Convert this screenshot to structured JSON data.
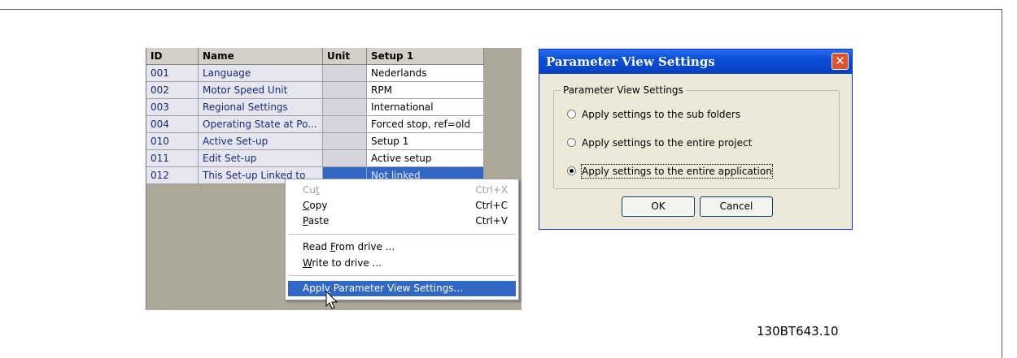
{
  "grid": {
    "columns": [
      "ID",
      "Name",
      "Unit",
      "Setup 1"
    ],
    "rows": [
      {
        "id": "001",
        "name": "Language",
        "unit": "",
        "value": "Nederlands"
      },
      {
        "id": "002",
        "name": "Motor Speed Unit",
        "unit": "",
        "value": "RPM"
      },
      {
        "id": "003",
        "name": "Regional Settings",
        "unit": "",
        "value": "International"
      },
      {
        "id": "004",
        "name": "Operating State at Po...",
        "unit": "",
        "value": "Forced stop, ref=old"
      },
      {
        "id": "010",
        "name": "Active Set-up",
        "unit": "",
        "value": "Setup 1"
      },
      {
        "id": "011",
        "name": "Edit Set-up",
        "unit": "",
        "value": "Active setup"
      },
      {
        "id": "012",
        "name": "This Set-up Linked to",
        "unit": "",
        "value": "Not linked"
      }
    ]
  },
  "context_menu": {
    "cut": {
      "pre": "Cu",
      "key": "t",
      "post": "",
      "shortcut": "Ctrl+X"
    },
    "copy": {
      "pre": "",
      "key": "C",
      "post": "opy",
      "shortcut": "Ctrl+C"
    },
    "paste": {
      "pre": "",
      "key": "P",
      "post": "aste",
      "shortcut": "Ctrl+V"
    },
    "read": {
      "pre": "Read ",
      "key": "F",
      "post": "rom drive ..."
    },
    "write": {
      "pre": "",
      "key": "W",
      "post": "rite to drive ..."
    },
    "apply": {
      "pre": "Appl",
      "key": "y",
      "post": " Parameter View Settings..."
    }
  },
  "dialog": {
    "title": "Parameter View Settings",
    "close_glyph": "✕",
    "group_label": "Parameter View Settings",
    "options": [
      "Apply settings to the sub folders",
      "Apply settings to the entire project",
      "Apply settings to the entire application"
    ],
    "selected_index": 2,
    "ok_label": "OK",
    "cancel_label": "Cancel"
  },
  "figure_id": "130BT643.10"
}
